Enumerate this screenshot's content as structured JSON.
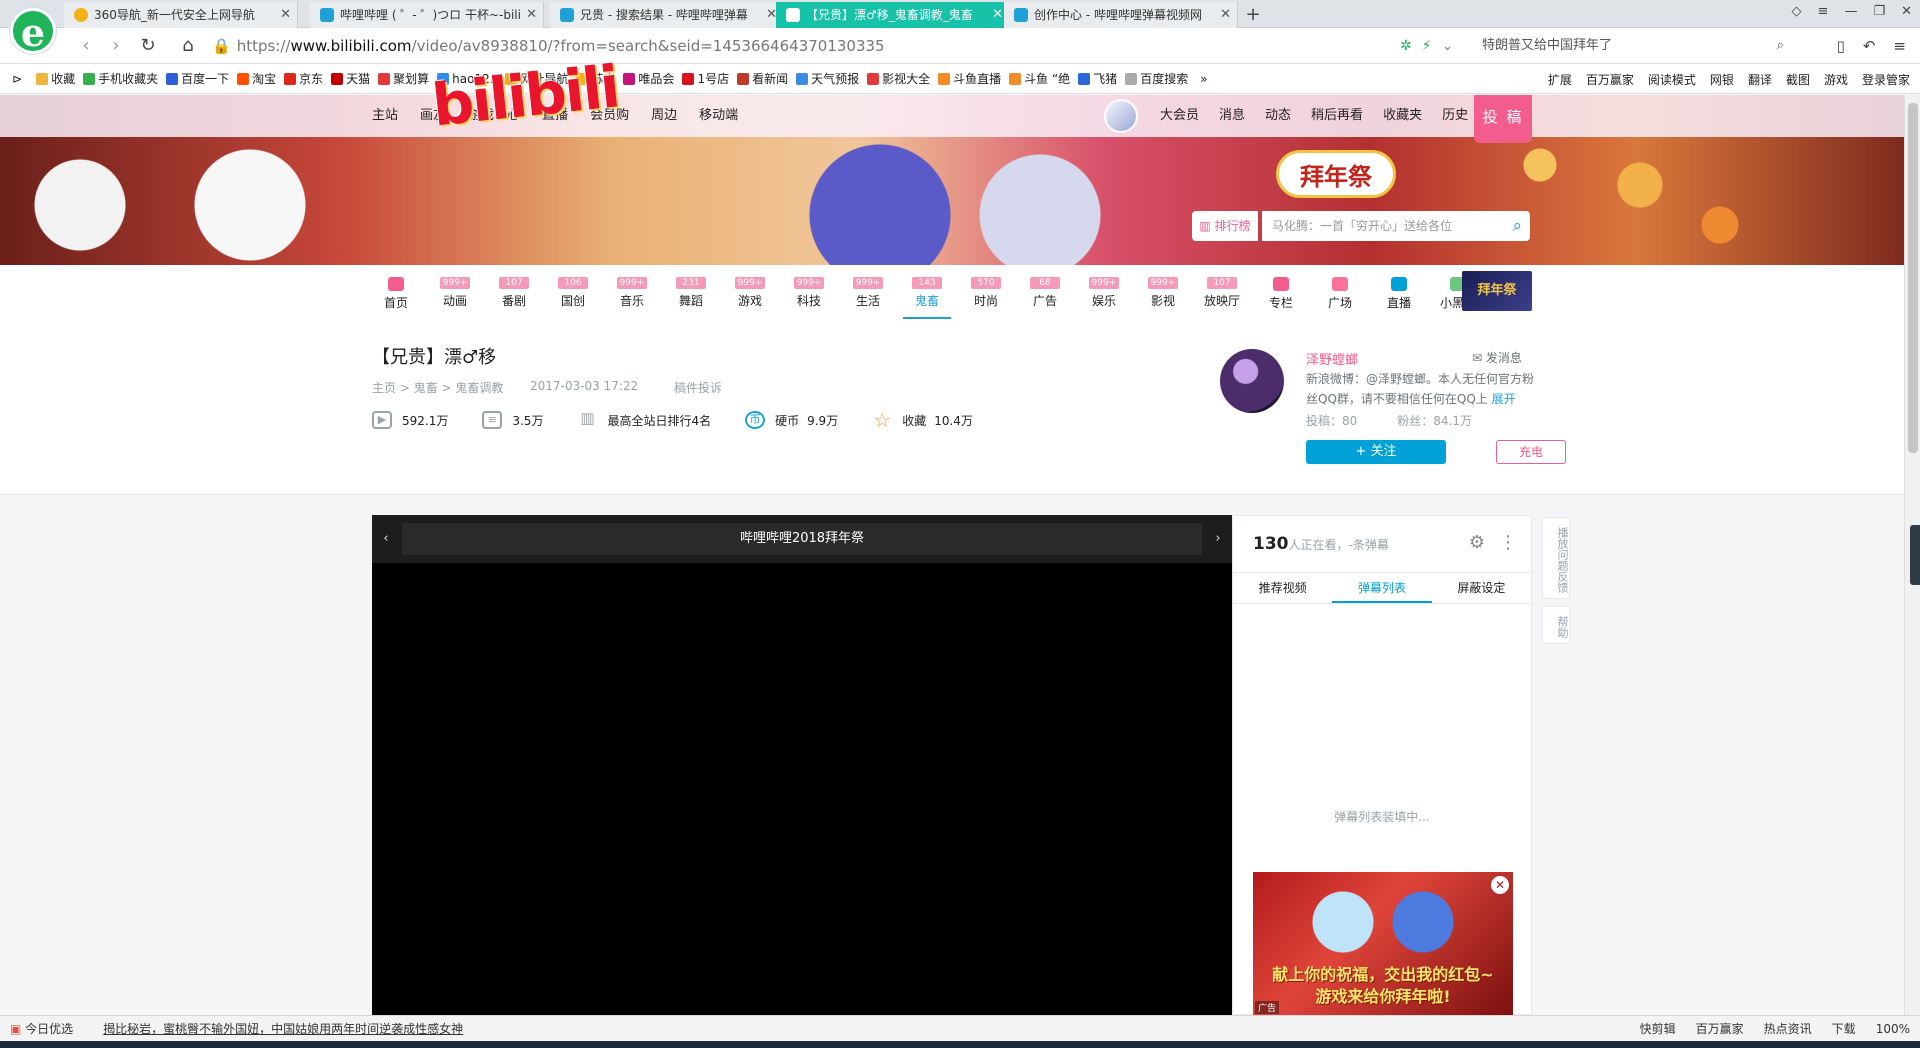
{
  "browser": {
    "tabs": [
      {
        "label": "360导航_新一代安全上网导航",
        "active": false
      },
      {
        "label": "哔哩哔哩 ( ゜- ゜)つロ 干杯~-bili",
        "active": false
      },
      {
        "label": "兄贵 - 搜索结果 - 哔哩哔哩弹幕",
        "active": false
      },
      {
        "label": "【兄贵】漂♂移_鬼畜调教_鬼畜",
        "active": true
      },
      {
        "label": "创作中心 - 哔哩哔哩弹幕视频网",
        "active": false
      }
    ],
    "url_scheme": "https://",
    "url_host": "www.bilibili.com",
    "url_path": "/video/av8938810/?from=search&seid=14536646437013033​5",
    "search_text": "特朗普又给中国拜年了",
    "bookmarks": [
      {
        "label": "收藏",
        "color": "#f0b63a"
      },
      {
        "label": "手机收藏夹",
        "color": "#35b04a"
      },
      {
        "label": "百度一下",
        "color": "#2e5fd8"
      },
      {
        "label": "淘宝",
        "color": "#ff5000"
      },
      {
        "label": "京东",
        "color": "#e1251b"
      },
      {
        "label": "天猫",
        "color": "#c40000"
      },
      {
        "label": "聚划算",
        "color": "#e4393c"
      },
      {
        "label": "hao123",
        "color": "#2f8ded"
      },
      {
        "label": "网址导航",
        "color": "#f5a623"
      },
      {
        "label": "苏宁",
        "color": "#f2b11a"
      },
      {
        "label": "唯品会",
        "color": "#c6147a"
      },
      {
        "label": "1号店",
        "color": "#d8121e"
      },
      {
        "label": "看新闻",
        "color": "#c0392b"
      },
      {
        "label": "天气预报",
        "color": "#3a8de0"
      },
      {
        "label": "影视大全",
        "color": "#e23a3a"
      },
      {
        "label": "斗鱼直播",
        "color": "#f28c28"
      },
      {
        "label": "斗鱼 “绝",
        "color": "#f28c28"
      },
      {
        "label": "飞猪",
        "color": "#2a68d8"
      },
      {
        "label": "百度搜索",
        "color": "#aaaaaa"
      }
    ],
    "bookmark_tools": [
      "扩展",
      "百万赢家",
      "阅读模式",
      "网银",
      "翻译",
      "截图",
      "游戏",
      "登录管家"
    ]
  },
  "site": {
    "topnav_left": [
      "主站",
      "画友",
      "游戏中心",
      "直播",
      "会员购",
      "周边",
      "移动端"
    ],
    "topnav_right": [
      "大会员",
      "消息",
      "动态",
      "稍后再看",
      "收藏夹",
      "历史"
    ],
    "upload_label": "投 稿",
    "logo_text": "bilibili",
    "festival_text": "拜年祭",
    "rank_label": "排行榜",
    "search_placeholder": "马化腾：一首「穷开心」送给各位",
    "categories": [
      {
        "label": "首页",
        "badge": "",
        "active": false
      },
      {
        "label": "动画",
        "badge": "999+",
        "active": false
      },
      {
        "label": "番剧",
        "badge": "107",
        "active": false
      },
      {
        "label": "国创",
        "badge": "106",
        "active": false
      },
      {
        "label": "音乐",
        "badge": "999+",
        "active": false
      },
      {
        "label": "舞蹈",
        "badge": "231",
        "active": false
      },
      {
        "label": "游戏",
        "badge": "999+",
        "active": false
      },
      {
        "label": "科技",
        "badge": "999+",
        "active": false
      },
      {
        "label": "生活",
        "badge": "999+",
        "active": false
      },
      {
        "label": "鬼畜",
        "badge": "143",
        "active": true
      },
      {
        "label": "时尚",
        "badge": "570",
        "active": false
      },
      {
        "label": "广告",
        "badge": "68",
        "active": false
      },
      {
        "label": "娱乐",
        "badge": "999+",
        "active": false
      },
      {
        "label": "影视",
        "badge": "999+",
        "active": false
      },
      {
        "label": "放映厅",
        "badge": "107",
        "active": false
      },
      {
        "label": "专栏",
        "badge": "",
        "active": false
      },
      {
        "label": "广场",
        "badge": "",
        "active": false
      },
      {
        "label": "直播",
        "badge": "",
        "active": false
      },
      {
        "label": "小黑屋",
        "badge": "",
        "active": false
      }
    ],
    "festival_mini": "拜年祭"
  },
  "video": {
    "title": "【兄贵】漂♂移",
    "crumbs": [
      "主页",
      "鬼畜",
      "鬼畜调教"
    ],
    "date": "2017-03-03 17:22",
    "complain": "稿件投诉",
    "views": "592.1万",
    "danmaku_count": "3.5万",
    "rank": "最高全站日排行4名",
    "coins_label": "硬币",
    "coins": "9.9万",
    "favs_label": "收藏",
    "favs": "10.4万"
  },
  "uploader": {
    "name": "泽野螳螂",
    "message": "发消息",
    "desc": "新浪微博：@泽野螳螂。本人无任何官方粉丝QQ群，请不要相信任何在QQ上",
    "more": "展开",
    "posts": "投稿：80",
    "fans": "粉丝：84.1万",
    "follow": "+ 关注",
    "charge": "充电"
  },
  "player": {
    "title": "哔哩哔哩2018拜年祭",
    "watching": "130",
    "watching_suffix": "人正在看，-条弹幕",
    "tabs": [
      "推荐视频",
      "弹幕列表",
      "屏蔽设定"
    ],
    "active_tab": "弹幕列表",
    "loading": "弹幕列表装填中...",
    "ad_slogan_1": "献上你的祝福，交出我的红包~",
    "ad_slogan_2": "游戏来给你拜年啦!",
    "ad_tag": "广告",
    "feedback": "播放问题反馈",
    "help": "帮助"
  },
  "statusbar": {
    "left": [
      "今日优选",
      "揭比秘岩，蜜桃臀不输外国妞，中国姑娘用两年时间逆袭成性感女神"
    ],
    "right": [
      "快剪辑",
      "百万赢家",
      "热点资讯",
      "下载",
      "100%"
    ]
  }
}
